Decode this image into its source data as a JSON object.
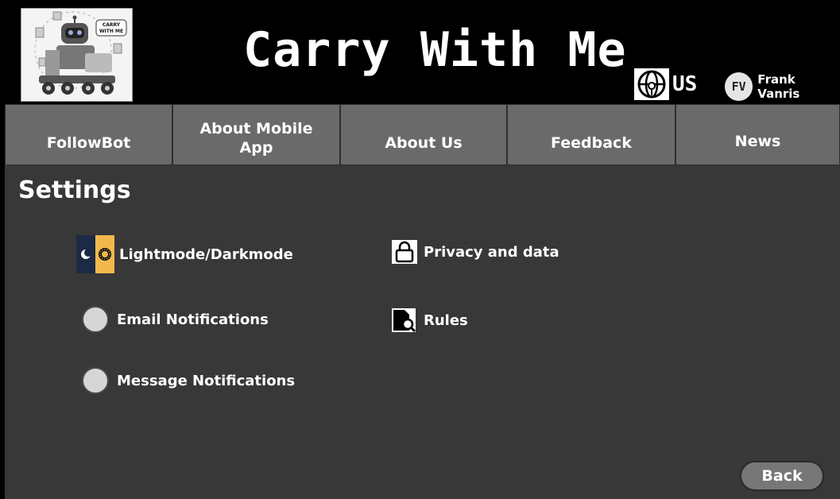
{
  "header": {
    "app_title": "Carry With Me",
    "locale": "US",
    "user": {
      "initials": "FV",
      "name": "Frank Vanris"
    },
    "logo": {
      "badge_text": "CARRY WITH ME"
    }
  },
  "nav": {
    "items": [
      {
        "label": "FollowBot"
      },
      {
        "label": "About Mobile App"
      },
      {
        "label": "About Us"
      },
      {
        "label": "Feedback"
      },
      {
        "label": "News"
      }
    ]
  },
  "main": {
    "title": "Settings",
    "settings": {
      "theme": {
        "label": "Lightmode/Darkmode",
        "icon": "moon-sun-icon"
      },
      "email": {
        "label": "Email Notifications"
      },
      "message": {
        "label": "Message Notifications"
      },
      "privacy": {
        "label": "Privacy and data",
        "icon": "lock-icon"
      },
      "rules": {
        "label": "Rules",
        "icon": "document-search-icon"
      }
    },
    "back_label": "Back"
  },
  "colors": {
    "header_bg": "#000000",
    "nav_bg": "#6a6a6a",
    "main_bg": "#383838",
    "button_bg": "#777777"
  }
}
